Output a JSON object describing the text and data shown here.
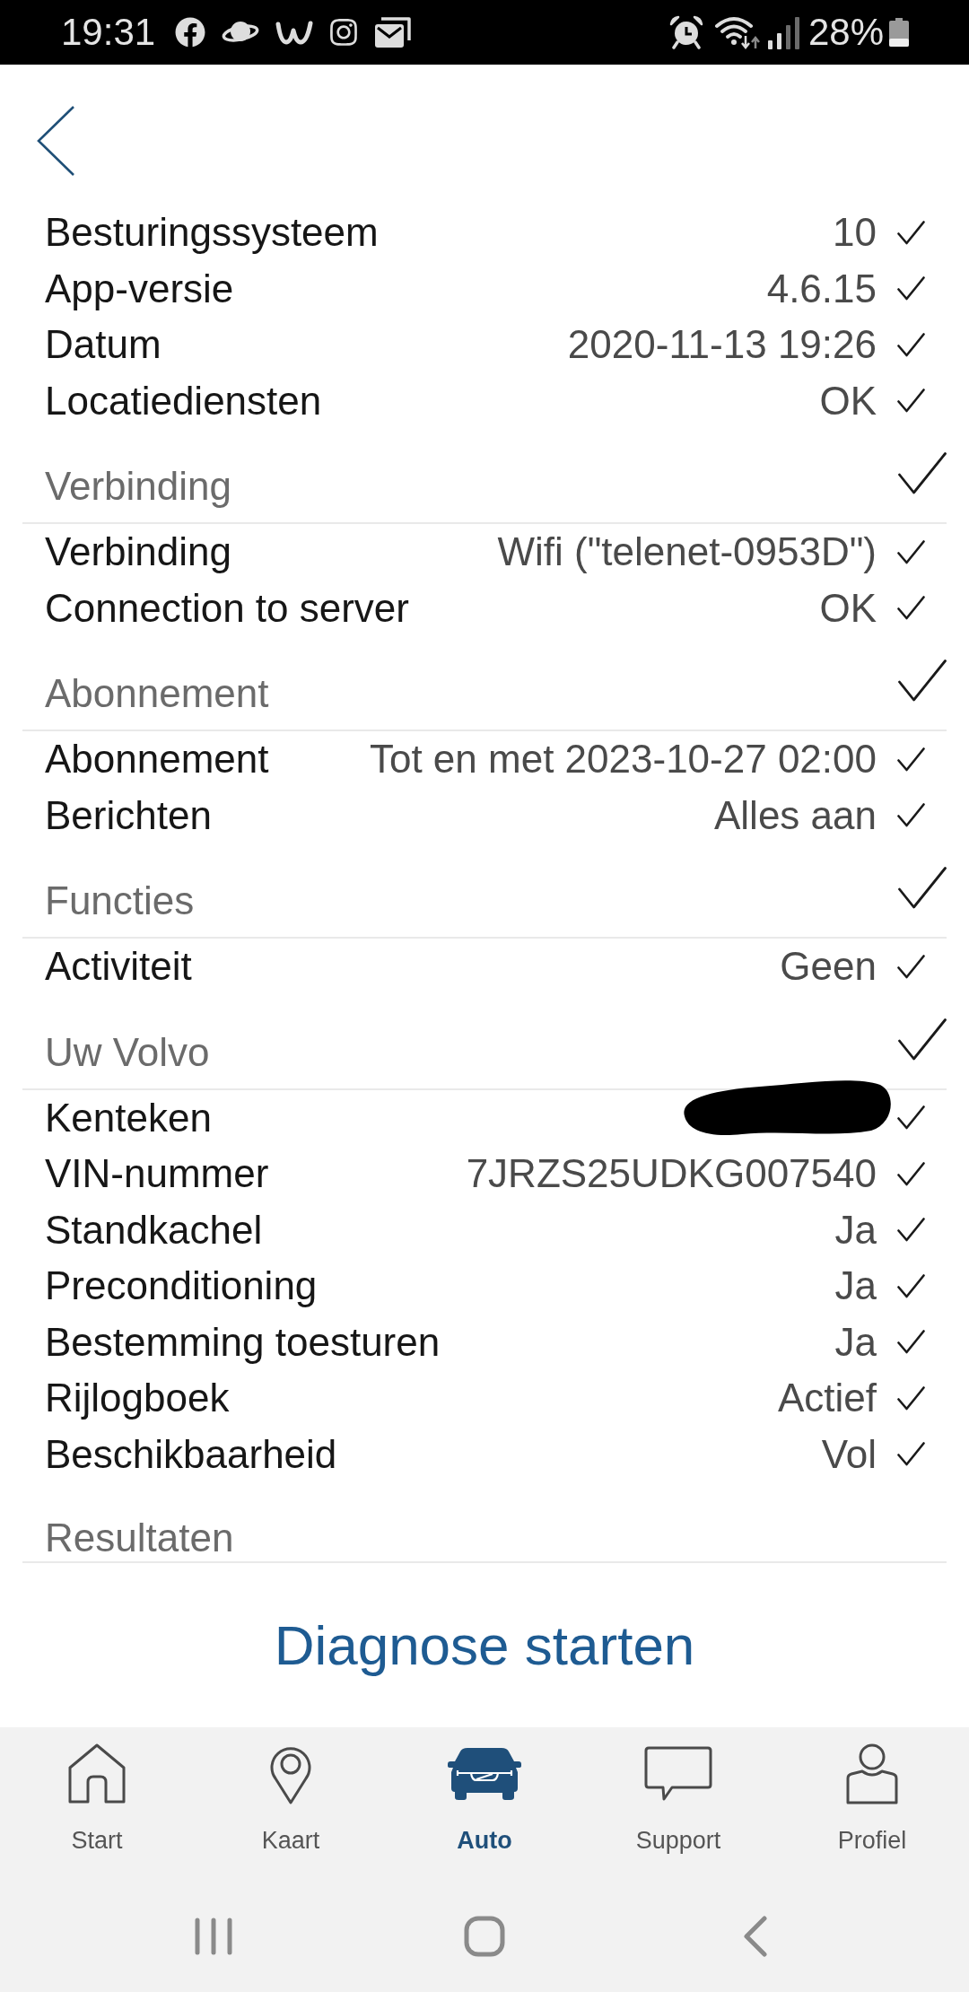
{
  "status_bar": {
    "time": "19:31",
    "battery": "28%"
  },
  "general": [
    {
      "label": "Besturingssysteem",
      "value": "10",
      "checked": true
    },
    {
      "label": "App-versie",
      "value": "4.6.15",
      "checked": true
    },
    {
      "label": "Datum",
      "value": "2020-11-13 19:26",
      "checked": true
    },
    {
      "label": "Locatiediensten",
      "value": "OK",
      "checked": true
    }
  ],
  "sections": [
    {
      "title": "Verbinding",
      "checked": true,
      "rows": [
        {
          "label": "Verbinding",
          "value": "Wifi (\"telenet-0953D\")",
          "checked": true
        },
        {
          "label": "Connection to server",
          "value": "OK",
          "checked": true
        }
      ]
    },
    {
      "title": "Abonnement",
      "checked": true,
      "rows": [
        {
          "label": "Abonnement",
          "value": "Tot en met 2023-10-27 02:00",
          "checked": true
        },
        {
          "label": "Berichten",
          "value": "Alles aan",
          "checked": true
        }
      ]
    },
    {
      "title": "Functies",
      "checked": true,
      "rows": [
        {
          "label": "Activiteit",
          "value": "Geen",
          "checked": true
        }
      ]
    },
    {
      "title": "Uw Volvo",
      "checked": true,
      "rows": [
        {
          "label": "Kenteken",
          "redacted": true,
          "checked": true
        },
        {
          "label": "VIN-nummer",
          "value": "7JRZS25UDKG007540",
          "checked": true
        },
        {
          "label": "Standkachel",
          "value": "Ja",
          "checked": true
        },
        {
          "label": "Preconditioning",
          "value": "Ja",
          "checked": true
        },
        {
          "label": "Bestemming toesturen",
          "value": "Ja",
          "checked": true
        },
        {
          "label": "Rijlogboek",
          "value": "Actief",
          "checked": true
        },
        {
          "label": "Beschikbaarheid",
          "value": "Vol",
          "checked": true
        }
      ]
    },
    {
      "title": "Resultaten",
      "checked": false
    }
  ],
  "action": {
    "label": "Diagnose starten"
  },
  "tabs": [
    {
      "label": "Start",
      "selected": false
    },
    {
      "label": "Kaart",
      "selected": false
    },
    {
      "label": "Auto",
      "selected": true
    },
    {
      "label": "Support",
      "selected": false
    },
    {
      "label": "Profiel",
      "selected": false
    }
  ]
}
